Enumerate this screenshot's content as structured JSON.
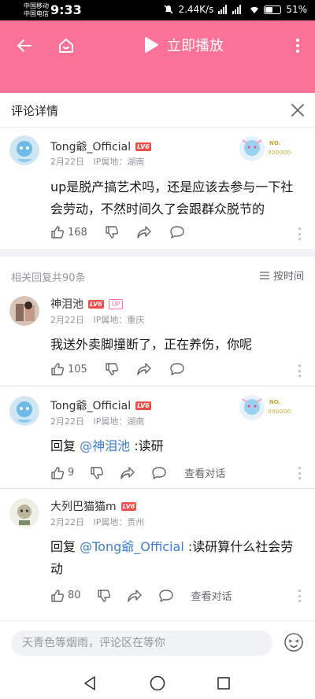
{
  "status_bar": {
    "carrier_1": "中国移动",
    "carrier_2": "中国电信",
    "time": "9:33",
    "speed": "2.44K/s",
    "battery": "51%",
    "battery_level": 0.51
  },
  "header": {
    "play_label": "立即播放",
    "color": "#fb7299"
  },
  "panel": {
    "title": "评论详情"
  },
  "root_comment": {
    "username": "Tong爺_Official",
    "level": "LV6",
    "badge_text": "NO.",
    "badge_number": "000000",
    "date": "2月22日",
    "location": "IP属地：湖南",
    "text": "up是脱产搞艺术吗，还是应该去参与一下社会劳动，不然时间久了会跟群众脱节的",
    "likes": "168"
  },
  "replies_header": {
    "count_label": "相关回复共90条",
    "sort_label": "按时间"
  },
  "replies": [
    {
      "username": "神泪池",
      "level": "LV6",
      "up_tag": "UP",
      "date": "2月22日",
      "location": "IP属地：重庆",
      "text": "我送外卖脚撞断了，正在养伤，你呢",
      "likes": "105"
    },
    {
      "username": "Tong爺_Official",
      "level": "LV6",
      "badge_text": "NO.",
      "badge_number": "000000",
      "date": "2月22日",
      "location": "IP属地：湖南",
      "reply_prefix": "回复 ",
      "mention": "@神泪池",
      "text": " :读研",
      "likes": "9",
      "view_conversation": "查看对话"
    },
    {
      "username": "大列巴猫猫m",
      "level": "LV6",
      "date": "2月22日",
      "location": "IP属地：贵州",
      "reply_prefix": "回复 ",
      "mention": "@Tong爺_Official",
      "text": " :读研算什么社会劳动",
      "likes": "80",
      "view_conversation": "查看对话"
    }
  ],
  "input": {
    "placeholder": "天青色等烟雨，评论区在等你"
  }
}
